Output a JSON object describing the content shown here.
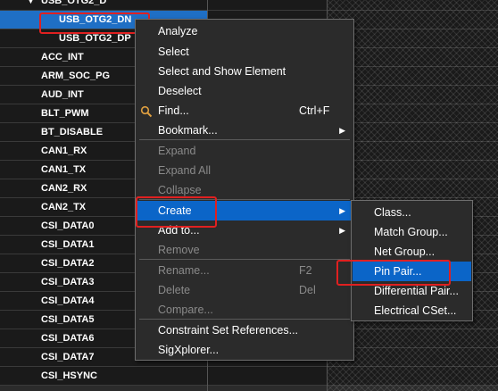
{
  "tree": {
    "parent": {
      "toggle": "▼",
      "label": "USB_OTG2_D"
    },
    "rows": [
      "USB_OTG2_DN",
      "USB_OTG2_DP",
      "ACC_INT",
      "ARM_SOC_PG",
      "AUD_INT",
      "BLT_PWM",
      "BT_DISABLE",
      "CAN1_RX",
      "CAN1_TX",
      "CAN2_RX",
      "CAN2_TX",
      "CSI_DATA0",
      "CSI_DATA1",
      "CSI_DATA2",
      "CSI_DATA3",
      "CSI_DATA4",
      "CSI_DATA5",
      "CSI_DATA6",
      "CSI_DATA7",
      "CSI_HSYNC"
    ],
    "selected": "USB_OTG2_DN"
  },
  "context_menu": {
    "items": [
      {
        "label": "Analyze",
        "shortcut": "",
        "enabled": true
      },
      {
        "label": "Select",
        "shortcut": "",
        "enabled": true
      },
      {
        "label": "Select and Show Element",
        "shortcut": "",
        "enabled": true
      },
      {
        "label": "Deselect",
        "shortcut": "",
        "enabled": true
      },
      {
        "label": "Find...",
        "shortcut": "Ctrl+F",
        "enabled": true,
        "icon": "find-icon"
      },
      {
        "label": "Bookmark...",
        "shortcut": "",
        "enabled": true,
        "submenu": true
      },
      {
        "label": "Expand",
        "shortcut": "",
        "enabled": false
      },
      {
        "label": "Expand All",
        "shortcut": "",
        "enabled": false
      },
      {
        "label": "Collapse",
        "shortcut": "",
        "enabled": false
      },
      {
        "label": "Create",
        "shortcut": "",
        "enabled": true,
        "submenu": true,
        "highlighted": true
      },
      {
        "label": "Add to...",
        "shortcut": "",
        "enabled": true,
        "submenu": true
      },
      {
        "label": "Remove",
        "shortcut": "",
        "enabled": false
      },
      {
        "label": "Rename...",
        "shortcut": "F2",
        "enabled": false
      },
      {
        "label": "Delete",
        "shortcut": "Del",
        "enabled": false
      },
      {
        "label": "Compare...",
        "shortcut": "",
        "enabled": false
      },
      {
        "label": "Constraint Set References...",
        "shortcut": "",
        "enabled": true
      },
      {
        "label": "SigXplorer...",
        "shortcut": "",
        "enabled": true
      }
    ],
    "submenu_arrow": "▶"
  },
  "create_submenu": {
    "items": [
      {
        "label": "Class...",
        "highlighted": false
      },
      {
        "label": "Match Group...",
        "highlighted": false
      },
      {
        "label": "Net Group...",
        "highlighted": false
      },
      {
        "label": "Pin Pair...",
        "highlighted": true
      },
      {
        "label": "Differential Pair...",
        "highlighted": false
      },
      {
        "label": "Electrical CSet...",
        "highlighted": false
      }
    ]
  },
  "colors": {
    "highlight": "#0b65c8",
    "annotation": "#e02020",
    "selection": "#1f6fc5"
  }
}
